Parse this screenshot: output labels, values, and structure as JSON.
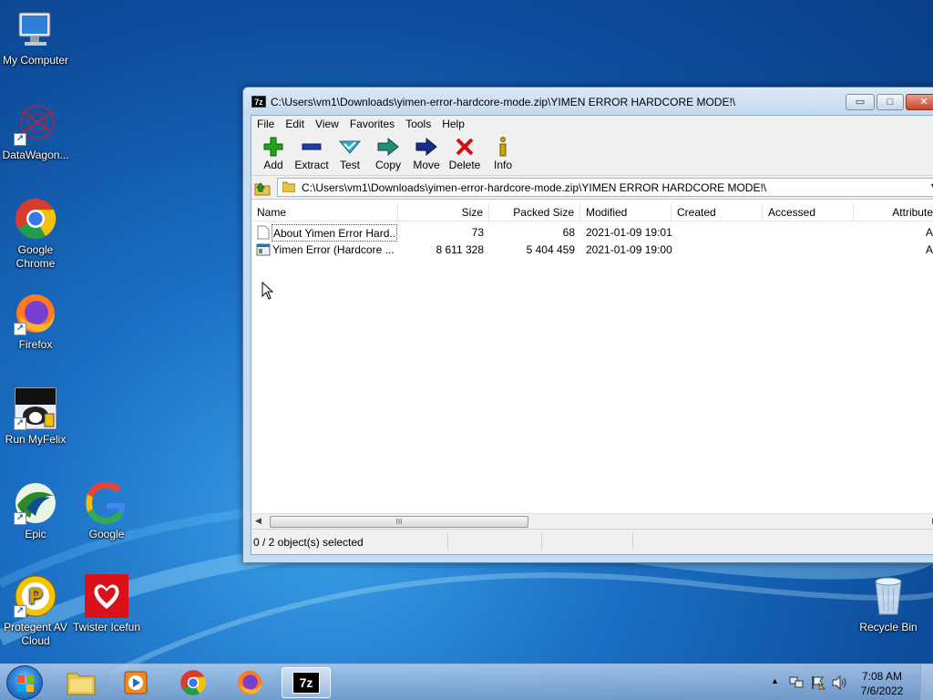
{
  "desktop": {
    "icons": [
      {
        "label": "My Computer"
      },
      {
        "label": "DataWagon..."
      },
      {
        "label": "Google Chrome"
      },
      {
        "label": "Firefox"
      },
      {
        "label": "Run MyFelix"
      },
      {
        "label": "Epic"
      },
      {
        "label": "Google"
      },
      {
        "label": "Protegent AV Cloud"
      },
      {
        "label": "Twister Icefun"
      },
      {
        "label": "Recycle Bin"
      }
    ]
  },
  "window": {
    "app_icon_text": "7z",
    "title": "C:\\Users\\vm1\\Downloads\\yimen-error-hardcore-mode.zip\\YIMEN ERROR HARDCORE MODE!\\",
    "minimize_glyph": "▭",
    "maximize_glyph": "□",
    "close_glyph": "✕",
    "menu": [
      "File",
      "Edit",
      "View",
      "Favorites",
      "Tools",
      "Help"
    ],
    "toolbar": [
      "Add",
      "Extract",
      "Test",
      "Copy",
      "Move",
      "Delete",
      "Info"
    ],
    "address": "C:\\Users\\vm1\\Downloads\\yimen-error-hardcore-mode.zip\\YIMEN ERROR HARDCORE MODE!\\",
    "columns": [
      "Name",
      "Size",
      "Packed Size",
      "Modified",
      "Created",
      "Accessed",
      "Attributes"
    ],
    "rows": [
      {
        "name": "About Yimen Error Hard...",
        "size": "73",
        "packed": "68",
        "modified": "2021-01-09 19:01",
        "attr": "A"
      },
      {
        "name": "Yimen Error (Hardcore ...",
        "size": "8 611 328",
        "packed": "5 404 459",
        "modified": "2021-01-09 19:00",
        "attr": "A"
      }
    ],
    "scroll_thumb": "III",
    "status": "0 / 2 object(s) selected"
  },
  "colors": {
    "add": "#1aa81a",
    "extract": "#1e3fa8",
    "test": "#2bb0c8",
    "copy": "#1f8f7a",
    "move": "#1a2d8c",
    "delete": "#d01010",
    "info": "#c8a800"
  },
  "taskbar": {
    "apps": [
      "explorer-icon",
      "media-player-icon",
      "chrome-icon",
      "firefox-icon",
      "7zip-icon"
    ],
    "active_app_text": "7z",
    "tray_arrow": "▲",
    "clock_time": "7:08 AM",
    "clock_date": "7/6/2022"
  }
}
